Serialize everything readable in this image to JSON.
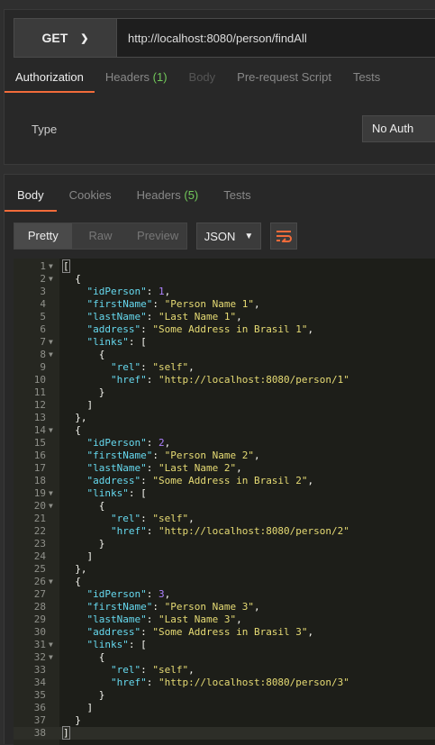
{
  "request": {
    "method": "GET",
    "url": "http://localhost:8080/person/findAll",
    "tabs": [
      {
        "label": "Authorization",
        "count": "",
        "state": "active"
      },
      {
        "label": "Headers",
        "count": "(1)",
        "state": ""
      },
      {
        "label": "Body",
        "count": "",
        "state": "dim"
      },
      {
        "label": "Pre-request Script",
        "count": "",
        "state": ""
      },
      {
        "label": "Tests",
        "count": "",
        "state": ""
      }
    ],
    "auth_type_label": "Type",
    "auth_type_value": "No Auth"
  },
  "response": {
    "tabs": [
      {
        "label": "Body",
        "count": "",
        "state": "active"
      },
      {
        "label": "Cookies",
        "count": "",
        "state": ""
      },
      {
        "label": "Headers",
        "count": "(5)",
        "state": ""
      },
      {
        "label": "Tests",
        "count": "",
        "state": ""
      }
    ],
    "formats": [
      "Pretty",
      "Raw",
      "Preview"
    ],
    "active_format": "Pretty",
    "language": "JSON",
    "body_lines": [
      "[",
      "  {",
      "    \"idPerson\": 1,",
      "    \"firstName\": \"Person Name 1\",",
      "    \"lastName\": \"Last Name 1\",",
      "    \"address\": \"Some Address in Brasil 1\",",
      "    \"links\": [",
      "      {",
      "        \"rel\": \"self\",",
      "        \"href\": \"http://localhost:8080/person/1\"",
      "      }",
      "    ]",
      "  },",
      "  {",
      "    \"idPerson\": 2,",
      "    \"firstName\": \"Person Name 2\",",
      "    \"lastName\": \"Last Name 2\",",
      "    \"address\": \"Some Address in Brasil 2\",",
      "    \"links\": [",
      "      {",
      "        \"rel\": \"self\",",
      "        \"href\": \"http://localhost:8080/person/2\"",
      "      }",
      "    ]",
      "  },",
      "  {",
      "    \"idPerson\": 3,",
      "    \"firstName\": \"Person Name 3\",",
      "    \"lastName\": \"Last Name 3\",",
      "    \"address\": \"Some Address in Brasil 3\",",
      "    \"links\": [",
      "      {",
      "        \"rel\": \"self\",",
      "        \"href\": \"http://localhost:8080/person/3\"",
      "      }",
      "    ]",
      "  }",
      "]"
    ],
    "foldable_lines": [
      1,
      2,
      7,
      8,
      14,
      19,
      20,
      26,
      31,
      32
    ]
  },
  "colors": {
    "accent": "#f26b3a",
    "count": "#72c85a",
    "key": "#66d9ef",
    "string": "#e6db74",
    "number": "#ae81ff"
  },
  "icons": {
    "method_dropdown": "chevron-down-icon",
    "language_dropdown": "chevron-down-icon",
    "wrap": "wrap-lines-icon",
    "fold": "fold-arrow-icon"
  }
}
